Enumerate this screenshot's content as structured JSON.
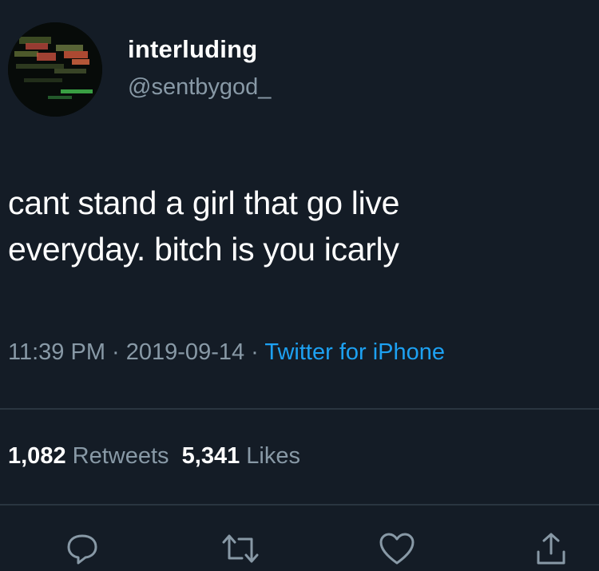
{
  "user": {
    "display_name": "interluding",
    "handle": "@sentbygod_"
  },
  "tweet": {
    "text_line1": "cant stand a girl that go live",
    "text_line2": "everyday. bitch is you icarly"
  },
  "meta": {
    "time": "11:39 PM",
    "separator1": " · ",
    "date": "2019-09-14",
    "separator2": " · ",
    "source": "Twitter for iPhone"
  },
  "stats": {
    "retweets_count": "1,082",
    "retweets_label": "Retweets",
    "likes_count": "5,341",
    "likes_label": "Likes"
  },
  "actions": [
    {
      "icon": "reply-icon"
    },
    {
      "icon": "retweet-icon"
    },
    {
      "icon": "like-icon"
    },
    {
      "icon": "share-icon"
    }
  ],
  "colors": {
    "background": "#141c26",
    "text_primary": "#ffffff",
    "text_secondary": "#8899a6",
    "link": "#1da1f2",
    "divider": "#2a3540"
  }
}
